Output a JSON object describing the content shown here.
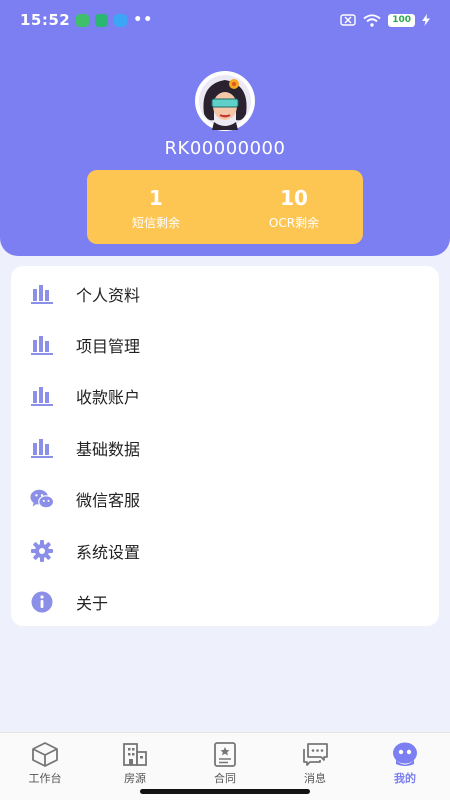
{
  "status_bar": {
    "time": "15:52",
    "dots": "••",
    "battery": "100"
  },
  "profile": {
    "username": "RK00000000"
  },
  "stats": [
    {
      "value": "1",
      "label": "短信剩余"
    },
    {
      "value": "10",
      "label": "OCR剩余"
    }
  ],
  "menu": {
    "items": [
      {
        "label": "个人资料",
        "icon": "bar-chart-icon"
      },
      {
        "label": "项目管理",
        "icon": "bar-chart-icon"
      },
      {
        "label": "收款账户",
        "icon": "bar-chart-icon"
      },
      {
        "label": "基础数据",
        "icon": "bar-chart-icon"
      },
      {
        "label": "微信客服",
        "icon": "wechat-icon"
      },
      {
        "label": "系统设置",
        "icon": "gear-icon"
      },
      {
        "label": "关于",
        "icon": "info-icon"
      }
    ]
  },
  "tabbar": {
    "tabs": [
      {
        "label": "工作台",
        "icon": "cube-icon"
      },
      {
        "label": "房源",
        "icon": "building-icon"
      },
      {
        "label": "合同",
        "icon": "contract-icon"
      },
      {
        "label": "消息",
        "icon": "message-icon"
      },
      {
        "label": "我的",
        "icon": "profile-icon",
        "active": true
      }
    ]
  },
  "colors": {
    "accent": "#7b7ff2",
    "stats_card": "#fdc653",
    "background": "#eef0fb"
  }
}
